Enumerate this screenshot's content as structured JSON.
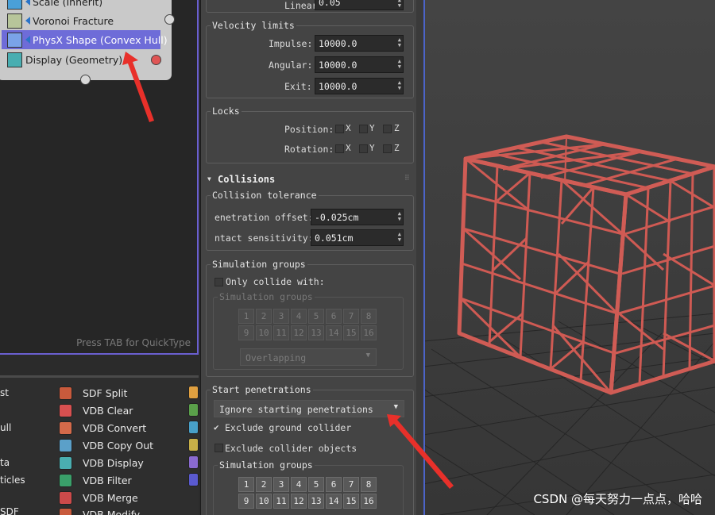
{
  "node_editor": {
    "rows": [
      {
        "label": "Scale (Inherit)"
      },
      {
        "label": "Voronoi Fracture"
      },
      {
        "label": "PhysX Shape (Convex Hull)"
      },
      {
        "label": "Display (Geometry)"
      }
    ],
    "quicktype_hint": "Press TAB for QuickType"
  },
  "node_list": {
    "left_fragments": [
      "st",
      "ull",
      "ta",
      "ticles",
      "SDF"
    ],
    "items": [
      {
        "label": "SDF Split",
        "color": "#c85a3c"
      },
      {
        "label": "VDB Clear",
        "color": "#d85050"
      },
      {
        "label": "VDB Convert",
        "color": "#d46a4a"
      },
      {
        "label": "VDB Copy Out",
        "color": "#5ba0c9"
      },
      {
        "label": "VDB Display",
        "color": "#4aaeb0"
      },
      {
        "label": "VDB Filter",
        "color": "#3aa06a"
      },
      {
        "label": "VDB Merge",
        "color": "#cc4a4a"
      },
      {
        "label": "VDB Modify",
        "color": "#c85a3c"
      }
    ],
    "right_icon_colors": [
      "#e0a040",
      "#5aa04a",
      "#48a0c8",
      "#c8b048",
      "#8a6ad0",
      "#5a5ad0"
    ]
  },
  "settings": {
    "linear_label": "Linear:",
    "linear_value": "0.05",
    "velocity_limits": {
      "title": "Velocity limits",
      "impulse_label": "Impulse:",
      "impulse_value": "10000.0",
      "angular_label": "Angular:",
      "angular_value": "10000.0",
      "exit_label": "Exit:",
      "exit_value": "10000.0"
    },
    "locks": {
      "title": "Locks",
      "position_label": "Position:",
      "rotation_label": "Rotation:",
      "axes": [
        "X",
        "Y",
        "Z"
      ]
    },
    "collisions": {
      "title": "Collisions",
      "tolerance_title": "Collision tolerance",
      "penetration_label": "enetration offset:",
      "penetration_value": "-0.025cm",
      "contact_label": "ntact sensitivity:",
      "contact_value": "0.051cm"
    },
    "simulation_groups": {
      "title": "Simulation groups",
      "only_collide_label": "Only collide with:",
      "inner_title": "Simulation groups",
      "buttons": [
        "1",
        "2",
        "3",
        "4",
        "5",
        "6",
        "7",
        "8",
        "9",
        "10",
        "11",
        "12",
        "13",
        "14",
        "15",
        "16"
      ],
      "dropdown_value": "Overlapping"
    },
    "start_penetrations": {
      "title": "Start penetrations",
      "dropdown_value": "Ignore starting penetrations",
      "exclude_ground_label": "Exclude ground collider",
      "exclude_ground_checked": true,
      "exclude_collider_label": "Exclude collider objects",
      "inner_title": "Simulation groups",
      "buttons": [
        "1",
        "2",
        "3",
        "4",
        "5",
        "6",
        "7",
        "8",
        "9",
        "10",
        "11",
        "12",
        "13",
        "14",
        "15",
        "16"
      ]
    }
  },
  "viewport": {
    "watermark": "CSDN @每天努力一点点，哈哈",
    "mesh_color": "#d05c55"
  },
  "colors": {
    "selection": "#6e6cd8",
    "annotation_arrow": "#e8302a",
    "viewport_border": "#4c64c8"
  }
}
